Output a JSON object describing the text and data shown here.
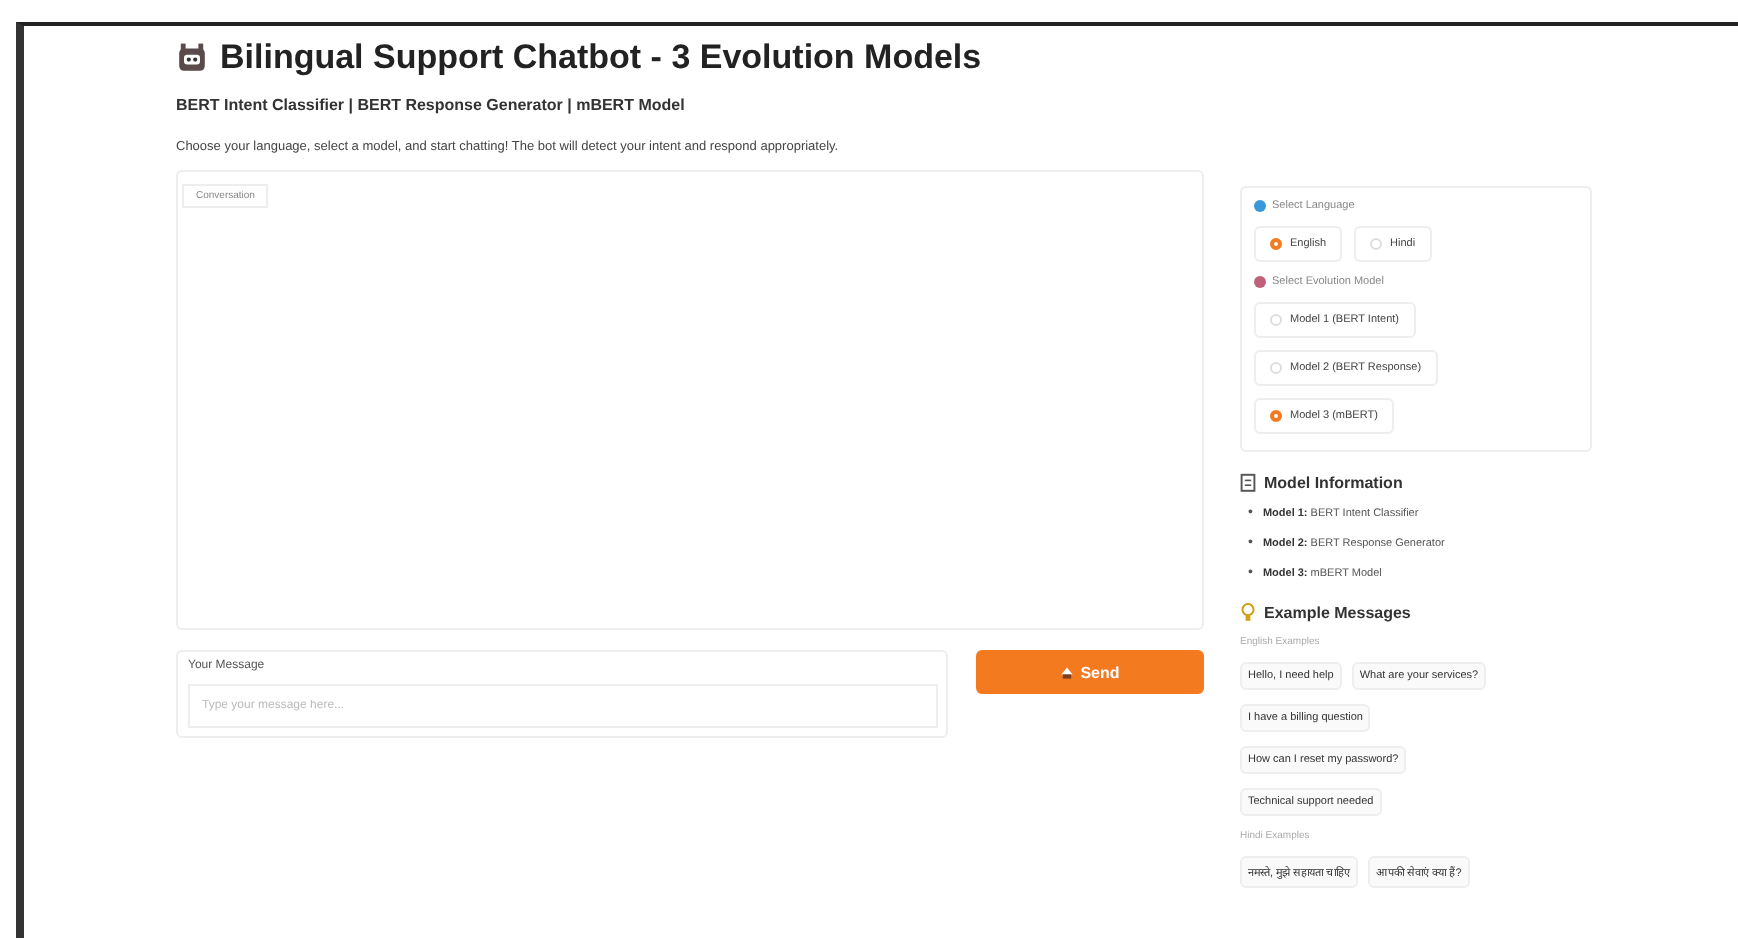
{
  "header": {
    "title": "Bilingual Support Chatbot - 3 Evolution Models",
    "subtitle": "BERT Intent Classifier | BERT Response Generator | mBERT Model",
    "description": "Choose your language, select a model, and start chatting! The bot will detect your intent and respond appropriately."
  },
  "chat": {
    "label": "Conversation"
  },
  "message": {
    "label": "Your Message",
    "placeholder": "Type your message here..."
  },
  "send_button": "Send",
  "language": {
    "label": "Select Language",
    "options": [
      {
        "label": "English",
        "selected": true
      },
      {
        "label": "Hindi",
        "selected": false
      }
    ]
  },
  "model": {
    "label": "Select Evolution Model",
    "options": [
      {
        "label": "Model 1 (BERT Intent)",
        "selected": false
      },
      {
        "label": "Model 2 (BERT Response)",
        "selected": false
      },
      {
        "label": "Model 3 (mBERT)",
        "selected": true
      }
    ]
  },
  "model_info": {
    "title": "Model Information",
    "items": [
      {
        "marker": "•",
        "name": "Model 1:",
        "text": "BERT Intent Classifier"
      },
      {
        "marker": "•",
        "name": "Model 2:",
        "text": "BERT Response Generator"
      },
      {
        "marker": "•",
        "name": "Model 3:",
        "text": "mBERT Model"
      }
    ]
  },
  "examples": {
    "title": "Example Messages",
    "groups": [
      {
        "label": "English Examples",
        "rows": [
          [
            "Hello, I need help",
            "What are your services?"
          ],
          [
            "I have a billing question"
          ],
          [
            "How can I reset my password?"
          ],
          [
            "Technical support needed"
          ]
        ]
      },
      {
        "label": "Hindi Examples",
        "rows": [
          [
            "नमस्ते, मुझे सहायता चाहिए",
            "आपकी सेवाएं क्या हैं?"
          ]
        ]
      }
    ]
  }
}
